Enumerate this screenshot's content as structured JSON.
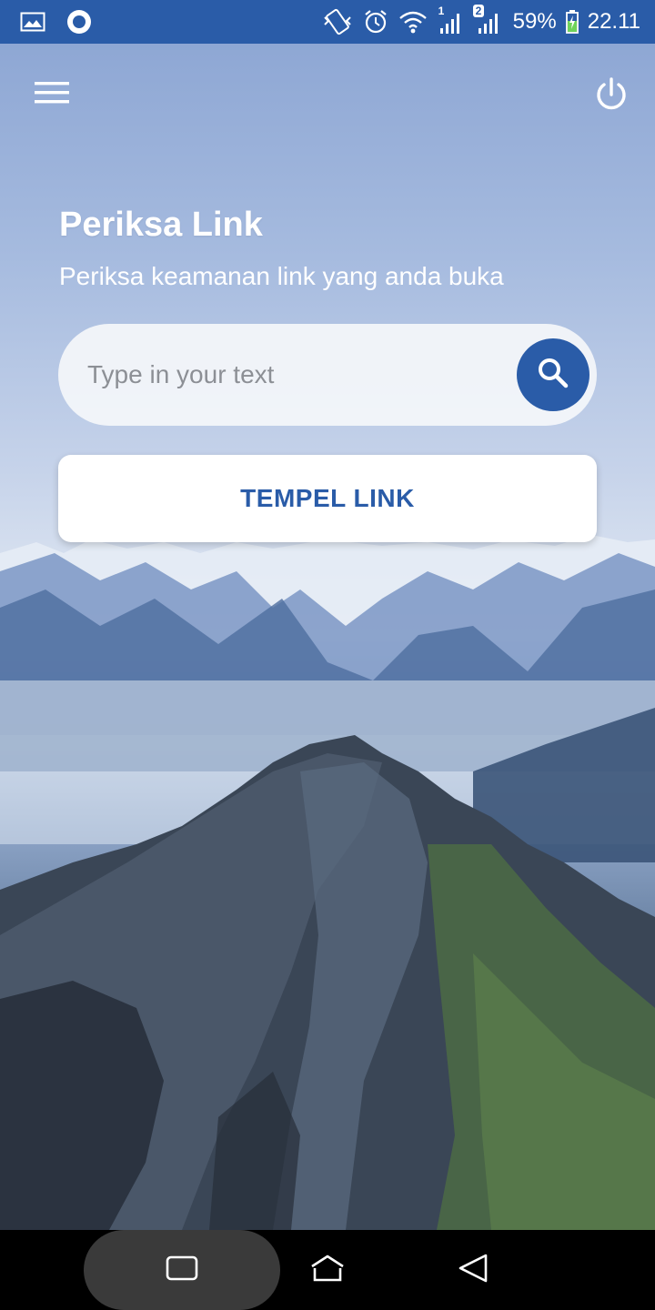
{
  "status_bar": {
    "battery": "59%",
    "time": "22.11",
    "sim_2_badge": "2",
    "sim_1_badge": "1",
    "icons": [
      "gallery-icon",
      "sync-circle-icon",
      "vibrate-icon",
      "alarm-icon",
      "wifi-icon",
      "signal-icon",
      "signal-icon",
      "battery-charging-icon"
    ]
  },
  "header": {
    "menu_icon": "hamburger-menu-icon",
    "power_icon": "power-icon"
  },
  "main": {
    "title": "Periksa Link",
    "subtitle": "Periksa keamanan link yang anda buka",
    "search": {
      "placeholder": "Type in your text",
      "value": "",
      "button_icon": "search-icon"
    },
    "paste_button_label": "TEMPEL LINK"
  },
  "navigation_bar": {
    "icons": [
      "recent-apps-icon",
      "home-icon",
      "back-icon"
    ]
  },
  "colors": {
    "accent": "#2a5ca8",
    "button_text": "#2a5ca8",
    "status_bar": "#2a5ca8"
  }
}
